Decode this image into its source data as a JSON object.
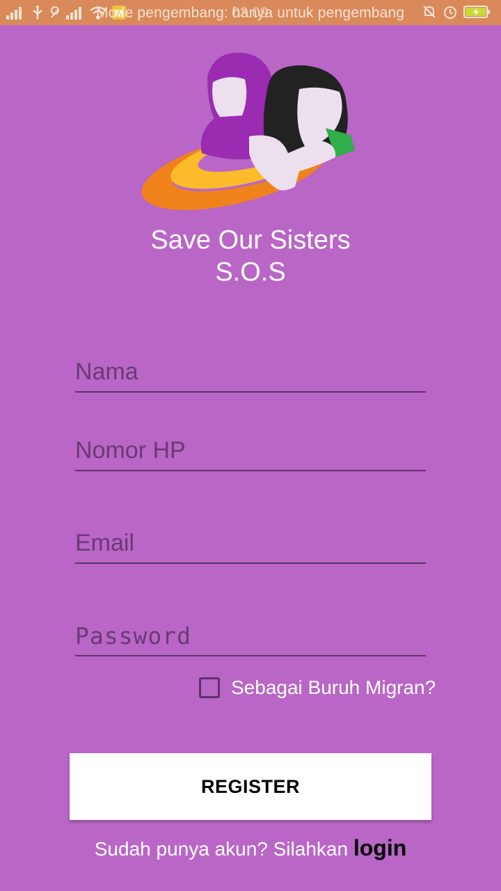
{
  "status_bar": {
    "message": "Mode pengembang: hanya untuk pengembang",
    "time": "03.09",
    "icons": [
      "signal-icon",
      "usb-icon",
      "wifi-icon",
      "notification-icon",
      "alarm-icon",
      "battery-icon"
    ]
  },
  "app": {
    "title_line1": "Save Our Sisters",
    "title_line2": "S.O.S"
  },
  "form": {
    "name_placeholder": "Nama",
    "phone_placeholder": "Nomor HP",
    "email_placeholder": "Email",
    "password_placeholder": "Password",
    "migrant_checkbox_label": "Sebagai Buruh Migran?",
    "migrant_checked": false,
    "register_label": "REGISTER"
  },
  "footer": {
    "prompt": "Sudah punya akun? Silahkan ",
    "login_label": "login"
  },
  "colors": {
    "background": "#b966c7",
    "status_bar": "#d9895a",
    "field_line": "#5b3566",
    "button": "#ffffff"
  }
}
